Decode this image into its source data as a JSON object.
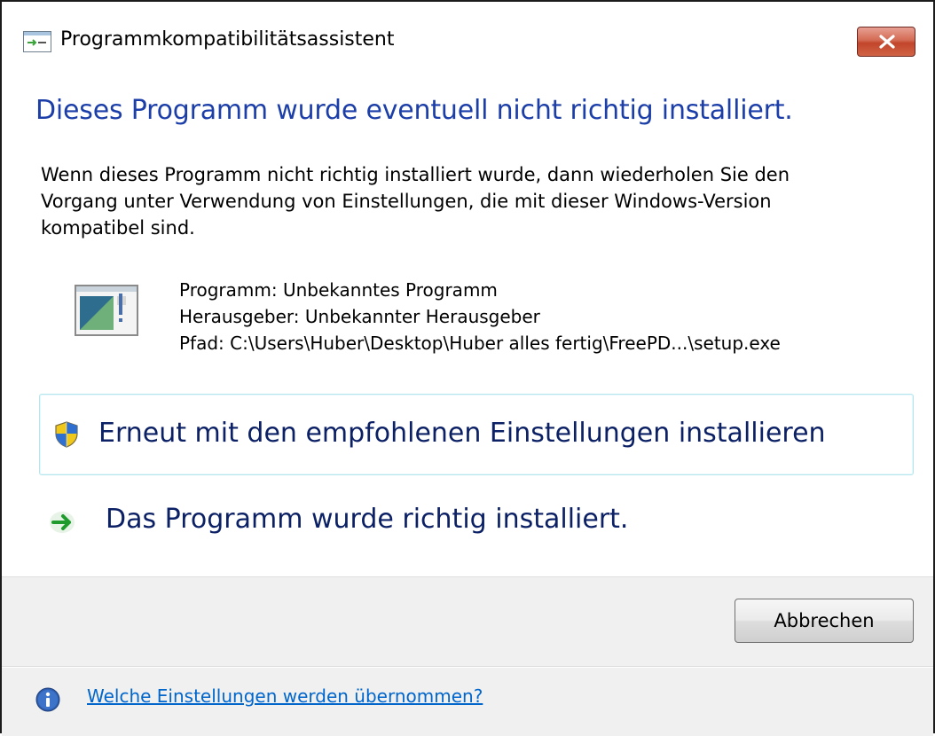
{
  "window": {
    "title": "Programmkompatibilitätsassistent"
  },
  "heading": "Dieses Programm wurde eventuell nicht richtig installiert.",
  "intro_lines": [
    "Wenn dieses Programm nicht richtig installiert wurde, dann wiederholen Sie den",
    "Vorgang unter Verwendung von Einstellungen, die mit dieser Windows-Version",
    "kompatibel sind."
  ],
  "program": {
    "name_line": "Programm: Unbekanntes Programm",
    "publisher_line": "Herausgeber: Unbekannter Herausgeber",
    "path_line": "Pfad: C:\\Users\\Huber\\Desktop\\Huber alles fertig\\FreePD...\\setup.exe"
  },
  "actions": {
    "reinstall_label": "Erneut mit den empfohlenen Einstellungen installieren",
    "installed_ok_label": "Das Programm wurde richtig installiert."
  },
  "footer": {
    "cancel_label": "Abbrechen",
    "help_link": "Welche Einstellungen werden übernommen?"
  },
  "icons": {
    "app": "compatibility-app-icon",
    "close": "close-icon",
    "program": "program-window-icon",
    "shield": "uac-shield-icon",
    "arrow": "green-arrow-icon",
    "info": "info-icon"
  },
  "colors": {
    "heading": "#1c3ea8",
    "command_text": "#0c2165",
    "link": "#0066cc",
    "footer_bg": "#f0f0f0",
    "close_button": "#c7452b"
  }
}
